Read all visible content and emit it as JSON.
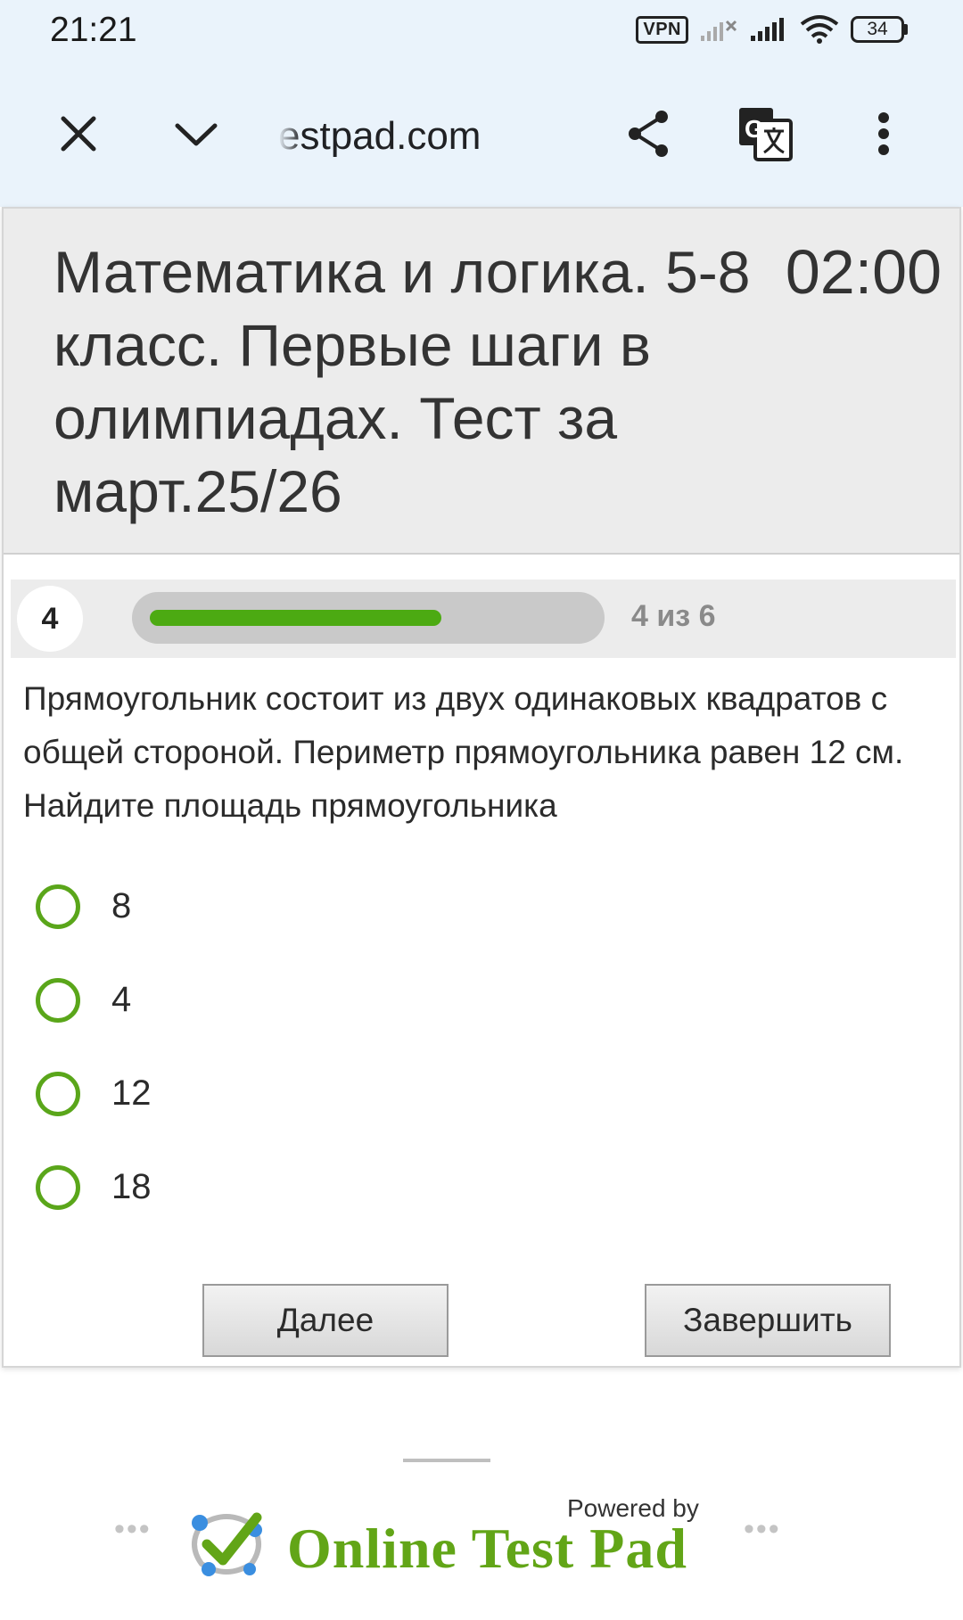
{
  "status_bar": {
    "time": "21:21",
    "vpn_label": "VPN",
    "battery_level": "34",
    "icons": [
      "vpn-icon",
      "signal-no-service-icon",
      "signal-icon",
      "wifi-icon",
      "battery-icon"
    ]
  },
  "browser": {
    "url": "estpad.com",
    "icons": [
      "close-icon",
      "chevron-down-icon",
      "share-icon",
      "translate-icon",
      "more-vert-icon"
    ]
  },
  "test": {
    "title": "Математика и логика. 5-8 класс. Первые шаги в олимпиадах. Тест за март.25/26",
    "timer": "02:00"
  },
  "progress": {
    "question_number": "4",
    "label": "4 из 6",
    "fraction": 0.667,
    "fill_color": "#4caa12"
  },
  "question": {
    "text": "Прямоугольник состоит из двух одинаковых квадратов с общей стороной. Периметр прямоугольника равен 12 см. Найдите площадь прямоугольника"
  },
  "answers": [
    {
      "label": "8",
      "selected": false
    },
    {
      "label": "4",
      "selected": false
    },
    {
      "label": "12",
      "selected": false
    },
    {
      "label": "18",
      "selected": false
    }
  ],
  "buttons": {
    "next_label": "Далее",
    "finish_label": "Завершить"
  },
  "footer": {
    "powered_by": "Powered by",
    "brand": "Online Test Pad",
    "brand_color": "#62a517"
  }
}
